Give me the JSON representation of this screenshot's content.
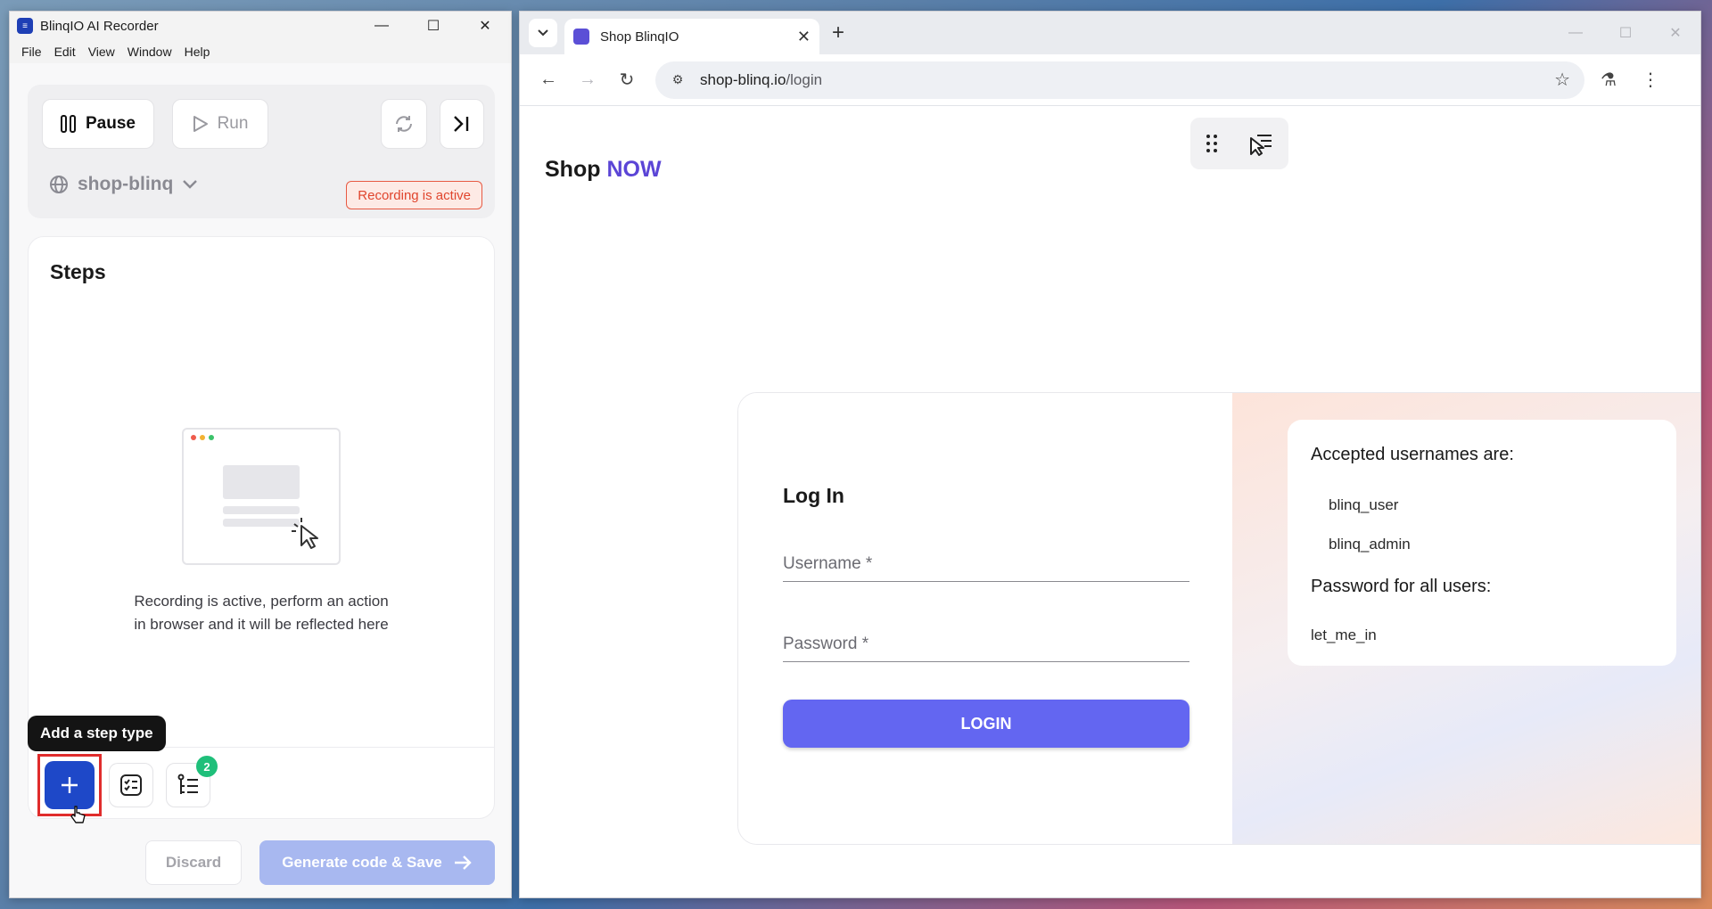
{
  "recorder": {
    "title": "BlinqIO AI Recorder",
    "menu": [
      "File",
      "Edit",
      "View",
      "Window",
      "Help"
    ],
    "pause_label": "Pause",
    "run_label": "Run",
    "project": "shop-blinq",
    "recording_badge": "Recording is active",
    "steps_title": "Steps",
    "empty_line1": "Recording is active, perform an action",
    "empty_line2": "in browser and it will be reflected here",
    "tooltip": "Add a step type",
    "steps_count": "2",
    "discard_label": "Discard",
    "generate_label": "Generate code & Save",
    "accent": "#1e48c8",
    "badge_color": "#e0452d"
  },
  "browser": {
    "tab_title": "Shop BlinqIO",
    "url_host": "shop-blinq.io",
    "url_path": "/login"
  },
  "page": {
    "logo_main": "Shop",
    "logo_accent": "NOW",
    "login_title": "Log In",
    "username_label": "Username *",
    "password_label": "Password *",
    "login_button": "LOGIN",
    "accepted_heading": "Accepted usernames are:",
    "usernames": [
      "blinq_user",
      "blinq_admin"
    ],
    "password_heading": "Password for all users:",
    "password_value": "let_me_in",
    "button_color": "#6366f1",
    "accent": "#5b45d6"
  },
  "icons": [
    "app-icon",
    "minimize-icon",
    "maximize-icon",
    "close-icon",
    "pause-icon",
    "play-icon",
    "refresh-icon",
    "skip-end-icon",
    "globe-icon",
    "chevron-down-icon",
    "cursor-click-icon",
    "plus-icon",
    "checklist-icon",
    "steps-list-icon",
    "arrow-right-icon",
    "back-icon",
    "forward-icon",
    "reload-icon",
    "site-settings-icon",
    "star-icon",
    "labs-icon",
    "more-icon",
    "drag-handle-icon",
    "recorder-pointer-icon"
  ]
}
